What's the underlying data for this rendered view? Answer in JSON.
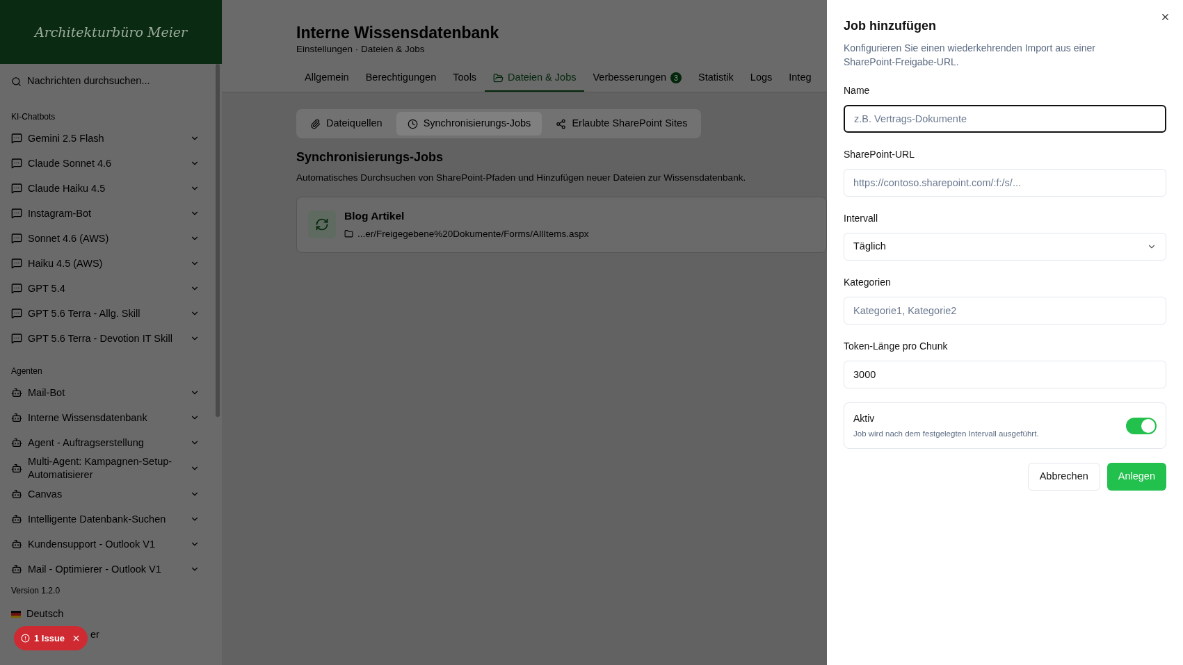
{
  "sidebar": {
    "logo": "Architekturbüro Meier",
    "search": {
      "placeholder": "Nachrichten durchsuchen..."
    },
    "sections": [
      {
        "title": "KI-Chatbots",
        "kind": "chat",
        "items": [
          "Gemini 2.5 Flash",
          "Claude Sonnet 4.6",
          "Claude Haiku 4.5",
          "Instagram-Bot",
          "Sonnet 4.6 (AWS)",
          "Haiku 4.5 (AWS)",
          "GPT 5.4",
          "GPT 5.6 Terra - Allg. Skill",
          "GPT 5.6 Terra - Devotion IT Skill"
        ]
      },
      {
        "title": "Agenten",
        "kind": "agent",
        "items": [
          "Mail-Bot",
          "Interne Wissensdatenbank",
          "Agent - Auftragserstellung",
          "Multi-Agent: Kampagnen-Setup-Automatisierer",
          "Canvas",
          "Intelligente Datenbank-Suchen",
          "Kundensupport - Outlook V1",
          "Mail - Optimierer - Outlook V1"
        ]
      }
    ],
    "version": "Version 1.2.0",
    "language": "Deutsch",
    "footer_item": "er"
  },
  "issue_badge": {
    "label": "1 Issue"
  },
  "page": {
    "title": "Interne Wissensdatenbank",
    "subtitle": "Einstellungen · Dateien & Jobs",
    "tabs": [
      {
        "label": "Allgemein",
        "selected": false
      },
      {
        "label": "Berechtigungen",
        "selected": false
      },
      {
        "label": "Tools",
        "selected": false
      },
      {
        "label": "Dateien & Jobs",
        "selected": true
      },
      {
        "label": "Verbesserungen",
        "selected": false,
        "badge": "3"
      },
      {
        "label": "Statistik",
        "selected": false
      },
      {
        "label": "Logs",
        "selected": false
      },
      {
        "label": "Integ",
        "selected": false
      }
    ],
    "subtabs": [
      {
        "label": "Dateiquellen",
        "selected": false
      },
      {
        "label": "Synchronisierungs-Jobs",
        "selected": true
      },
      {
        "label": "Erlaubte SharePoint Sites",
        "selected": false
      }
    ],
    "section_title": "Synchronisierungs-Jobs",
    "section_description": "Automatisches Durchsuchen von SharePoint-Pfaden und Hinzufügen neuer Dateien zur Wissensdatenbank.",
    "jobs": [
      {
        "name": "Blog Artikel",
        "path": "...er/Freigegebene%20Dokumente/Forms/AllItems.aspx"
      }
    ]
  },
  "drawer": {
    "title": "Job hinzufügen",
    "description": "Konfigurieren Sie einen wiederkehrenden Import aus einer SharePoint-Freigabe-URL.",
    "fields": [
      {
        "label": "Name",
        "kind": "text",
        "placeholder": "z.B. Vertrags-Dokumente",
        "focused": true
      },
      {
        "label": "SharePoint-URL",
        "kind": "text",
        "placeholder": "https://contoso.sharepoint.com/:f:/s/...",
        "focused": false
      },
      {
        "label": "Intervall",
        "kind": "select",
        "value": "Täglich",
        "focused": false
      },
      {
        "label": "Kategorien",
        "kind": "text",
        "placeholder": "Kategorie1, Kategorie2",
        "focused": false
      },
      {
        "label": "Token-Länge pro Chunk",
        "kind": "text",
        "value": "3000",
        "focused": false
      }
    ],
    "toggle": {
      "label": "Aktiv",
      "description": "Job wird nach dem festgelegten Intervall ausgeführt.",
      "on": true
    },
    "buttons": [
      {
        "label": "Abbrechen",
        "kind": "secondary"
      },
      {
        "label": "Anlegen",
        "kind": "primary"
      }
    ]
  }
}
